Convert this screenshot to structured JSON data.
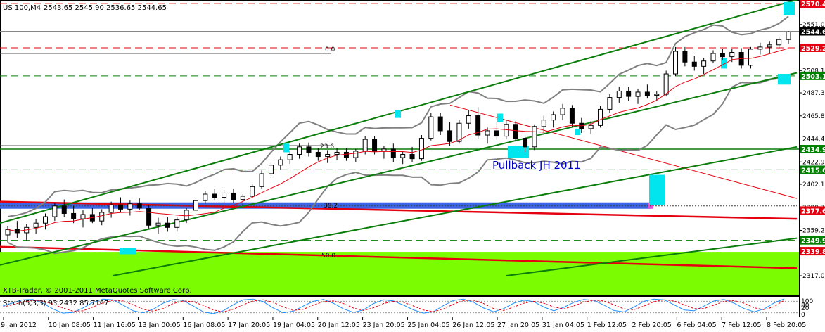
{
  "chart_data": {
    "type": "candlestick",
    "instrument": {
      "symbol": "US 100,M4",
      "ohlc_header": "2543.65 2545.90 2536.65 2544.65"
    },
    "broker_text": "XTB-Trader, © 2001-2011 MetaQuotes Software Corp.",
    "annotation_text": "Pullback JH 2011",
    "fib_labels": [
      "0.0",
      "23.6",
      "38.2",
      "50.0"
    ],
    "price_scale": {
      "ticks": [
        "2551.00",
        "2529.55",
        "2508.10",
        "2487.30",
        "2465.85",
        "2444.40",
        "2422.95",
        "2402.15",
        "2380.70",
        "2359.25",
        "2338.45",
        "2317.00"
      ],
      "range": [
        2317.0,
        2572.5
      ]
    },
    "level_labels": [
      {
        "value": "2570.43",
        "color": "#e4000f",
        "text_color": "#ffffff"
      },
      {
        "value": "2544.65",
        "color": "#000000",
        "text_color": "#ffffff"
      },
      {
        "value": "2529.28",
        "color": "#e4000f",
        "text_color": "#ffffff"
      },
      {
        "value": "2503.16",
        "color": "#008000",
        "text_color": "#ffffff"
      },
      {
        "value": "2434.90",
        "color": "#008000",
        "text_color": "#ffffff"
      },
      {
        "value": "2415.64",
        "color": "#008000",
        "text_color": "#ffffff"
      },
      {
        "value": "2377.67",
        "color": "#e4000f",
        "text_color": "#ffffff"
      },
      {
        "value": "2349.97",
        "color": "#008000",
        "text_color": "#ffffff"
      },
      {
        "value": "2339.87",
        "color": "#e4000f",
        "text_color": "#ffffff"
      }
    ],
    "time_axis": [
      "9 Jan 2012",
      "10 Jan 08:05",
      "11 Jan 16:05",
      "13 Jan 00:05",
      "16 Jan 08:05",
      "17 Jan 20:05",
      "19 Jan 04:05",
      "20 Jan 12:05",
      "23 Jan 20:05",
      "25 Jan 04:05",
      "26 Jan 12:05",
      "27 Jan 20:05",
      "31 Jan 04:05",
      "1 Feb 12:05",
      "2 Feb 20:05",
      "6 Feb 04:05",
      "7 Feb 12:05",
      "8 Feb 20:05"
    ],
    "stochastic": {
      "label": "Stoch(5,3,3) 93.2432 85.7107",
      "ticks": [
        "100",
        "80",
        "20",
        "0"
      ],
      "main": [
        55,
        72,
        88,
        90,
        70,
        40,
        18,
        22,
        45,
        75,
        92,
        88,
        60,
        30,
        20,
        38,
        70,
        90,
        85,
        55,
        25,
        15,
        30,
        62,
        88,
        92,
        78,
        45,
        20,
        28,
        55,
        80,
        90,
        70,
        40,
        22,
        35,
        68,
        88,
        82,
        60,
        35,
        18,
        26,
        58,
        85,
        92,
        75,
        45,
        25,
        42,
        70,
        86,
        78,
        50,
        30,
        48,
        75,
        90,
        85,
        60,
        32,
        24,
        50,
        80,
        92,
        88,
        62,
        35,
        30,
        55,
        82,
        90,
        70,
        42,
        25,
        40,
        72,
        93
      ],
      "signal": [
        50,
        62,
        77,
        85,
        82,
        65,
        45,
        28,
        30,
        50,
        72,
        86,
        82,
        62,
        38,
        28,
        42,
        68,
        82,
        78,
        58,
        35,
        24,
        38,
        62,
        82,
        88,
        75,
        50,
        32,
        38,
        60,
        78,
        82,
        68,
        45,
        32,
        46,
        68,
        80,
        75,
        55,
        34,
        26,
        40,
        65,
        84,
        86,
        68,
        42,
        32,
        50,
        70,
        80,
        70,
        50,
        40,
        56,
        76,
        86,
        82,
        62,
        40,
        36,
        55,
        78,
        88,
        82,
        62,
        42,
        42,
        60,
        80,
        84,
        70,
        46,
        36,
        52,
        86
      ]
    },
    "candles": [
      {
        "o": 2355,
        "h": 2363,
        "l": 2348,
        "c": 2360
      },
      {
        "o": 2360,
        "h": 2368,
        "l": 2352,
        "c": 2357
      },
      {
        "o": 2357,
        "h": 2365,
        "l": 2350,
        "c": 2362
      },
      {
        "o": 2362,
        "h": 2370,
        "l": 2356,
        "c": 2366
      },
      {
        "o": 2366,
        "h": 2375,
        "l": 2360,
        "c": 2372
      },
      {
        "o": 2372,
        "h": 2385,
        "l": 2368,
        "c": 2382
      },
      {
        "o": 2382,
        "h": 2388,
        "l": 2372,
        "c": 2375
      },
      {
        "o": 2375,
        "h": 2382,
        "l": 2366,
        "c": 2370
      },
      {
        "o": 2370,
        "h": 2378,
        "l": 2362,
        "c": 2374
      },
      {
        "o": 2374,
        "h": 2380,
        "l": 2366,
        "c": 2368
      },
      {
        "o": 2368,
        "h": 2379,
        "l": 2364,
        "c": 2376
      },
      {
        "o": 2376,
        "h": 2386,
        "l": 2371,
        "c": 2383
      },
      {
        "o": 2383,
        "h": 2390,
        "l": 2376,
        "c": 2379
      },
      {
        "o": 2379,
        "h": 2387,
        "l": 2373,
        "c": 2384
      },
      {
        "o": 2384,
        "h": 2389,
        "l": 2378,
        "c": 2380
      },
      {
        "o": 2380,
        "h": 2383,
        "l": 2361,
        "c": 2364
      },
      {
        "o": 2364,
        "h": 2371,
        "l": 2356,
        "c": 2366
      },
      {
        "o": 2366,
        "h": 2372,
        "l": 2358,
        "c": 2362
      },
      {
        "o": 2362,
        "h": 2372,
        "l": 2358,
        "c": 2369
      },
      {
        "o": 2369,
        "h": 2380,
        "l": 2366,
        "c": 2378
      },
      {
        "o": 2378,
        "h": 2389,
        "l": 2376,
        "c": 2387
      },
      {
        "o": 2387,
        "h": 2396,
        "l": 2384,
        "c": 2393
      },
      {
        "o": 2393,
        "h": 2398,
        "l": 2387,
        "c": 2390
      },
      {
        "o": 2390,
        "h": 2397,
        "l": 2385,
        "c": 2394
      },
      {
        "o": 2394,
        "h": 2398,
        "l": 2385,
        "c": 2388
      },
      {
        "o": 2388,
        "h": 2393,
        "l": 2382,
        "c": 2391
      },
      {
        "o": 2391,
        "h": 2402,
        "l": 2389,
        "c": 2400
      },
      {
        "o": 2400,
        "h": 2415,
        "l": 2398,
        "c": 2412
      },
      {
        "o": 2412,
        "h": 2423,
        "l": 2408,
        "c": 2420
      },
      {
        "o": 2420,
        "h": 2428,
        "l": 2416,
        "c": 2425
      },
      {
        "o": 2425,
        "h": 2433,
        "l": 2421,
        "c": 2430
      },
      {
        "o": 2430,
        "h": 2440,
        "l": 2426,
        "c": 2437
      },
      {
        "o": 2437,
        "h": 2441,
        "l": 2428,
        "c": 2432
      },
      {
        "o": 2432,
        "h": 2436,
        "l": 2424,
        "c": 2428
      },
      {
        "o": 2428,
        "h": 2434,
        "l": 2422,
        "c": 2430
      },
      {
        "o": 2430,
        "h": 2436,
        "l": 2425,
        "c": 2432
      },
      {
        "o": 2432,
        "h": 2436,
        "l": 2424,
        "c": 2427
      },
      {
        "o": 2427,
        "h": 2435,
        "l": 2423,
        "c": 2433
      },
      {
        "o": 2433,
        "h": 2447,
        "l": 2430,
        "c": 2444
      },
      {
        "o": 2444,
        "h": 2447,
        "l": 2430,
        "c": 2433
      },
      {
        "o": 2433,
        "h": 2438,
        "l": 2426,
        "c": 2435
      },
      {
        "o": 2435,
        "h": 2440,
        "l": 2423,
        "c": 2427
      },
      {
        "o": 2427,
        "h": 2433,
        "l": 2421,
        "c": 2430
      },
      {
        "o": 2430,
        "h": 2437,
        "l": 2423,
        "c": 2426
      },
      {
        "o": 2426,
        "h": 2448,
        "l": 2424,
        "c": 2445
      },
      {
        "o": 2445,
        "h": 2469,
        "l": 2443,
        "c": 2465
      },
      {
        "o": 2465,
        "h": 2469,
        "l": 2448,
        "c": 2452
      },
      {
        "o": 2452,
        "h": 2460,
        "l": 2438,
        "c": 2442
      },
      {
        "o": 2442,
        "h": 2462,
        "l": 2440,
        "c": 2459
      },
      {
        "o": 2459,
        "h": 2471,
        "l": 2454,
        "c": 2466
      },
      {
        "o": 2466,
        "h": 2474,
        "l": 2444,
        "c": 2448
      },
      {
        "o": 2448,
        "h": 2455,
        "l": 2440,
        "c": 2452
      },
      {
        "o": 2452,
        "h": 2460,
        "l": 2444,
        "c": 2447
      },
      {
        "o": 2447,
        "h": 2462,
        "l": 2444,
        "c": 2458
      },
      {
        "o": 2458,
        "h": 2461,
        "l": 2442,
        "c": 2445
      },
      {
        "o": 2445,
        "h": 2450,
        "l": 2432,
        "c": 2437
      },
      {
        "o": 2437,
        "h": 2458,
        "l": 2434,
        "c": 2456
      },
      {
        "o": 2456,
        "h": 2466,
        "l": 2450,
        "c": 2462
      },
      {
        "o": 2462,
        "h": 2470,
        "l": 2455,
        "c": 2467
      },
      {
        "o": 2467,
        "h": 2477,
        "l": 2462,
        "c": 2473
      },
      {
        "o": 2473,
        "h": 2476,
        "l": 2456,
        "c": 2459
      },
      {
        "o": 2459,
        "h": 2464,
        "l": 2450,
        "c": 2454
      },
      {
        "o": 2454,
        "h": 2461,
        "l": 2449,
        "c": 2457
      },
      {
        "o": 2457,
        "h": 2475,
        "l": 2455,
        "c": 2472
      },
      {
        "o": 2472,
        "h": 2486,
        "l": 2469,
        "c": 2483
      },
      {
        "o": 2483,
        "h": 2493,
        "l": 2478,
        "c": 2489
      },
      {
        "o": 2489,
        "h": 2493,
        "l": 2480,
        "c": 2484
      },
      {
        "o": 2484,
        "h": 2491,
        "l": 2477,
        "c": 2488
      },
      {
        "o": 2488,
        "h": 2495,
        "l": 2482,
        "c": 2485
      },
      {
        "o": 2485,
        "h": 2489,
        "l": 2480,
        "c": 2486
      },
      {
        "o": 2486,
        "h": 2508,
        "l": 2484,
        "c": 2505
      },
      {
        "o": 2505,
        "h": 2530,
        "l": 2503,
        "c": 2526
      },
      {
        "o": 2526,
        "h": 2530,
        "l": 2512,
        "c": 2516
      },
      {
        "o": 2516,
        "h": 2522,
        "l": 2508,
        "c": 2512
      },
      {
        "o": 2512,
        "h": 2520,
        "l": 2505,
        "c": 2517
      },
      {
        "o": 2517,
        "h": 2527,
        "l": 2515,
        "c": 2524
      },
      {
        "o": 2524,
        "h": 2528,
        "l": 2518,
        "c": 2521
      },
      {
        "o": 2521,
        "h": 2528,
        "l": 2516,
        "c": 2525
      },
      {
        "o": 2525,
        "h": 2529,
        "l": 2510,
        "c": 2513
      },
      {
        "o": 2513,
        "h": 2530,
        "l": 2510,
        "c": 2528
      },
      {
        "o": 2528,
        "h": 2534,
        "l": 2523,
        "c": 2530
      },
      {
        "o": 2530,
        "h": 2535,
        "l": 2524,
        "c": 2532
      },
      {
        "o": 2532,
        "h": 2540,
        "l": 2528,
        "c": 2537
      },
      {
        "o": 2537,
        "h": 2545,
        "l": 2533,
        "c": 2544
      }
    ],
    "grid": false
  },
  "colors": {
    "background": "#ffffff",
    "bull_candle": "#ffffff",
    "bear_candle": "#000000",
    "channel": "#0a7d0a",
    "support_red": "#e4000f",
    "fib_fill": "#7cfc00",
    "blue_band": "#3c64e6",
    "cyan_marker": "#00e5ee",
    "stoch_main": "#1e90ff",
    "stoch_signal": "#e4000f",
    "bollinger": "#808080"
  }
}
